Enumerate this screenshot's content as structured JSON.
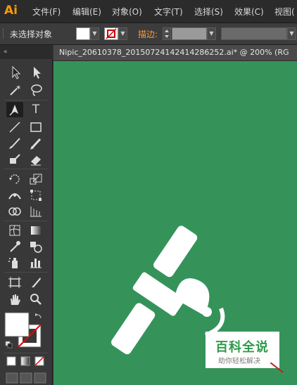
{
  "app": {
    "logo": "Ai"
  },
  "menu": {
    "items": [
      "文件(F)",
      "编辑(E)",
      "对象(O)",
      "文字(T)",
      "选择(S)",
      "效果(C)",
      "视图("
    ]
  },
  "control_bar": {
    "selection_label": "未选择对象",
    "stroke_label": "描边:"
  },
  "document": {
    "tab_title": "Nipic_20610378_20150724142414286252.ai*  @  200%  (RG"
  },
  "tools": {
    "rows": [
      [
        "selection-icon",
        "direct-selection-icon"
      ],
      [
        "magic-wand-icon",
        "lasso-icon"
      ],
      [
        "pen-icon",
        "type-icon"
      ],
      [
        "line-icon",
        "rectangle-icon"
      ],
      [
        "paintbrush-icon",
        "pencil-icon"
      ],
      [
        "blob-brush-icon",
        "eraser-icon"
      ],
      [
        "rotate-icon",
        "scale-icon"
      ],
      [
        "width-icon",
        "free-transform-icon"
      ],
      [
        "shape-builder-icon",
        "perspective-grid-icon"
      ],
      [
        "mesh-icon",
        "gradient-icon"
      ],
      [
        "eyedropper-icon",
        "blend-icon"
      ],
      [
        "symbol-sprayer-icon",
        "column-graph-icon"
      ],
      [
        "artboard-icon",
        "slice-icon"
      ],
      [
        "hand-icon",
        "zoom-icon"
      ]
    ],
    "type_glyph": "T"
  },
  "colors": {
    "canvas": "#35935a",
    "accent": "#ff9a00",
    "watermark_green": "#2f9a4a"
  },
  "watermark": {
    "title": "百科全说",
    "subtitle": "助你轻松解决"
  }
}
